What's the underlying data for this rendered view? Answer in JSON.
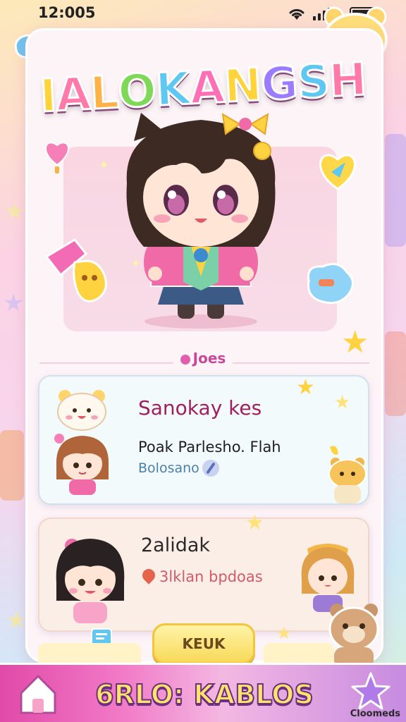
{
  "status_bar": {
    "time": "12:005"
  },
  "app": {
    "title_letters": [
      {
        "ch": "I",
        "color": "#ffd43b"
      },
      {
        "ch": "A",
        "color": "#ff7aa8"
      },
      {
        "ch": "L",
        "color": "#ffb347"
      },
      {
        "ch": "O",
        "color": "#7ed957"
      },
      {
        "ch": "K",
        "color": "#5ec8f2"
      },
      {
        "ch": "A",
        "color": "#ff6fb5"
      },
      {
        "ch": "N",
        "color": "#ffd43b"
      },
      {
        "ch": "G",
        "color": "#9b7bff"
      },
      {
        "ch": "S",
        "color": "#5ec8f2"
      },
      {
        "ch": "H",
        "color": "#ff7aa8"
      }
    ]
  },
  "section": {
    "label": "Joes"
  },
  "cards": [
    {
      "title": "Sanokay kes",
      "subtitle": "Poak Parlesho. Flah",
      "tag": "Bolosano"
    },
    {
      "title": "2alidak",
      "meta": "3lklan bpdoas"
    }
  ],
  "primary_button": {
    "label": "KEUK"
  },
  "bottom_bar": {
    "title": "6RLO: KABLOS",
    "caption": "Cloomeds"
  },
  "icons": {
    "status": [
      "wifi-icon",
      "signal-icon",
      "battery-icon"
    ],
    "bottom": [
      "home-icon",
      "star-icon"
    ]
  },
  "colors": {
    "accent_pink": "#e04aa8",
    "title_dark": "#a0205e",
    "button_yellow": "#f7d95a"
  }
}
